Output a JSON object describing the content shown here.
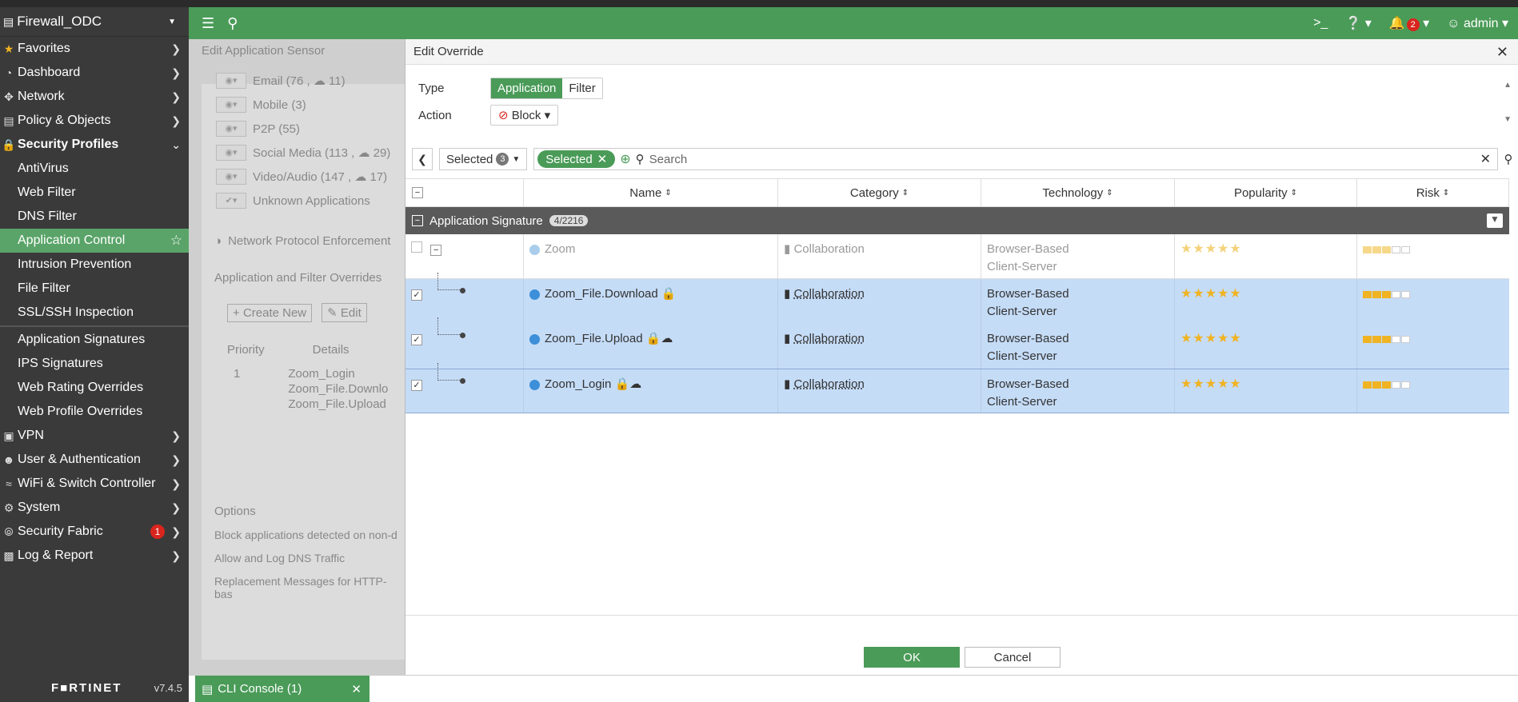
{
  "sidebar": {
    "device": "Firewall_ODC",
    "items": [
      {
        "label": "Favorites",
        "icon": "star-icon"
      },
      {
        "label": "Dashboard",
        "icon": "dashboard-icon"
      },
      {
        "label": "Network",
        "icon": "network-icon"
      },
      {
        "label": "Policy & Objects",
        "icon": "policy-icon"
      },
      {
        "label": "Security Profiles",
        "icon": "lock-icon"
      }
    ],
    "sub_items": [
      "AntiVirus",
      "Web Filter",
      "DNS Filter",
      "Application Control",
      "Intrusion Prevention",
      "File Filter",
      "SSL/SSH Inspection"
    ],
    "sub_items2": [
      "Application Signatures",
      "IPS Signatures",
      "Web Rating Overrides",
      "Web Profile Overrides"
    ],
    "items2": [
      {
        "label": "VPN",
        "icon": "vpn-icon"
      },
      {
        "label": "User & Authentication",
        "icon": "user-icon"
      },
      {
        "label": "WiFi & Switch Controller",
        "icon": "wifi-icon"
      },
      {
        "label": "System",
        "icon": "gear-icon"
      },
      {
        "label": "Security Fabric",
        "icon": "fabric-icon",
        "badge": "1"
      },
      {
        "label": "Log & Report",
        "icon": "chart-icon"
      }
    ],
    "brand": "F■RTINET",
    "version": "v7.4.5"
  },
  "topbar": {
    "user": "admin",
    "notifications": "2"
  },
  "background": {
    "title": "Edit Application Sensor",
    "categories": [
      "Email (76 , ☁ 11)",
      "Mobile (3)",
      "P2P (55)",
      "Social Media (113 , ☁ 29)",
      "Video/Audio (147 , ☁ 17)",
      "Unknown Applications"
    ],
    "npe": "Network Protocol Enforcement",
    "overrides_title": "Application and Filter Overrides",
    "create_new": "Create New",
    "edit": "Edit",
    "priority": "Priority",
    "details": "Details",
    "row_priority": "1",
    "row_details": [
      "Zoom_Login",
      "Zoom_File.Downlo",
      "Zoom_File.Upload"
    ],
    "options": "Options",
    "opt1": "Block applications detected on non-d",
    "opt2": "Allow and Log DNS Traffic",
    "opt3": "Replacement Messages for HTTP-bas"
  },
  "modal": {
    "title": "Edit Override",
    "type_label": "Type",
    "type_options": [
      "Application",
      "Filter"
    ],
    "action_label": "Action",
    "action_value": "Block",
    "selected_label": "Selected",
    "selected_count": "3",
    "chip": "Selected",
    "search_placeholder": "Search",
    "columns": [
      "Name",
      "Category",
      "Technology",
      "Popularity",
      "Risk"
    ],
    "group": {
      "label": "Application Signature",
      "count": "4/2216"
    },
    "rows": [
      {
        "name": "Zoom",
        "category": "Collaboration",
        "tech1": "Browser-Based",
        "tech2": "Client-Server",
        "stars": "★★★★★",
        "risk": 3
      },
      {
        "name": "Zoom_File.Download",
        "category": "Collaboration",
        "tech1": "Browser-Based",
        "tech2": "Client-Server",
        "stars": "★★★★★",
        "risk": 3
      },
      {
        "name": "Zoom_File.Upload",
        "category": "Collaboration",
        "tech1": "Browser-Based",
        "tech2": "Client-Server",
        "stars": "★★★★★",
        "risk": 3
      },
      {
        "name": "Zoom_Login",
        "category": "Collaboration",
        "tech1": "Browser-Based",
        "tech2": "Client-Server",
        "stars": "★★★★★",
        "risk": 3
      }
    ],
    "ok": "OK",
    "cancel": "Cancel"
  },
  "console": {
    "label": "CLI Console (1)"
  }
}
